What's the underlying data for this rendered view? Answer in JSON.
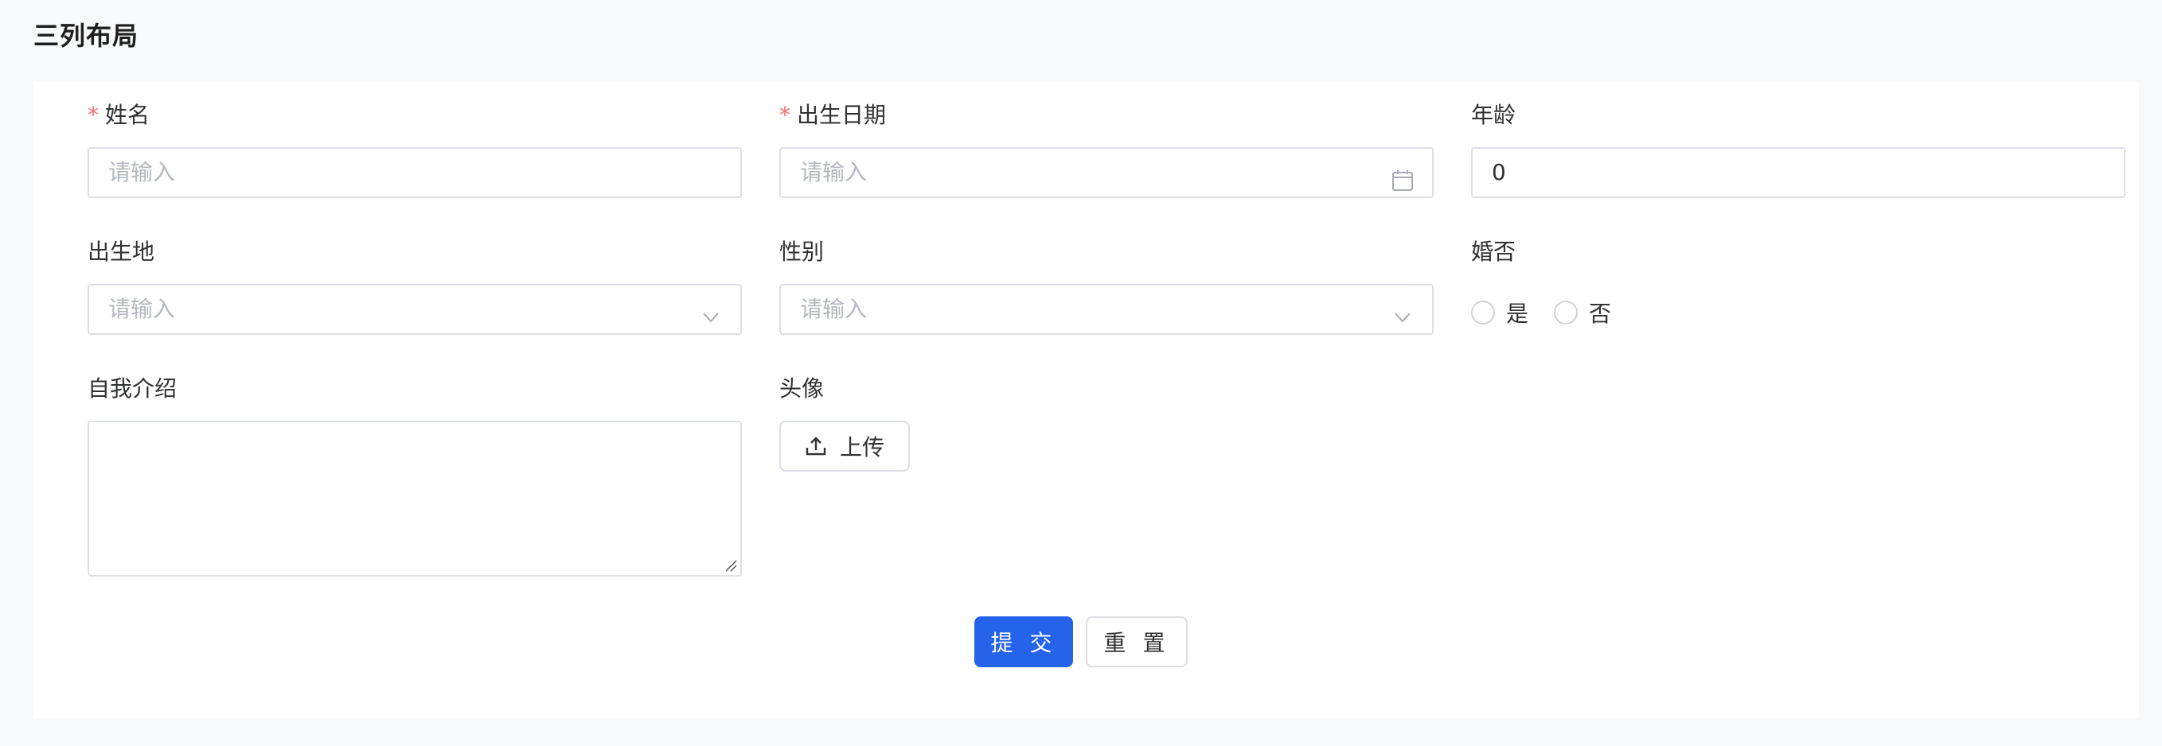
{
  "page": {
    "title": "三列布局"
  },
  "form": {
    "name": {
      "label": "姓名",
      "required": true,
      "placeholder": "请输入"
    },
    "birthdate": {
      "label": "出生日期",
      "required": true,
      "placeholder": "请输入",
      "icon": "calendar-icon"
    },
    "age": {
      "label": "年龄",
      "value": "0"
    },
    "birthplace": {
      "label": "出生地",
      "placeholder": "请输入",
      "icon": "chevron-down-icon"
    },
    "gender": {
      "label": "性别",
      "placeholder": "请输入",
      "icon": "chevron-down-icon"
    },
    "married": {
      "label": "婚否",
      "options": [
        "是",
        "否"
      ]
    },
    "intro": {
      "label": "自我介绍",
      "value": ""
    },
    "avatar": {
      "label": "头像",
      "upload_label": "上传",
      "icon": "upload-icon"
    },
    "required_mark": "*"
  },
  "actions": {
    "submit_label": "提 交",
    "reset_label": "重 置"
  },
  "colors": {
    "primary": "#2563eb",
    "required": "#f56c6c",
    "border": "#dcdfe6",
    "placeholder": "#b4b8bf",
    "background": "#f8f9fb"
  }
}
